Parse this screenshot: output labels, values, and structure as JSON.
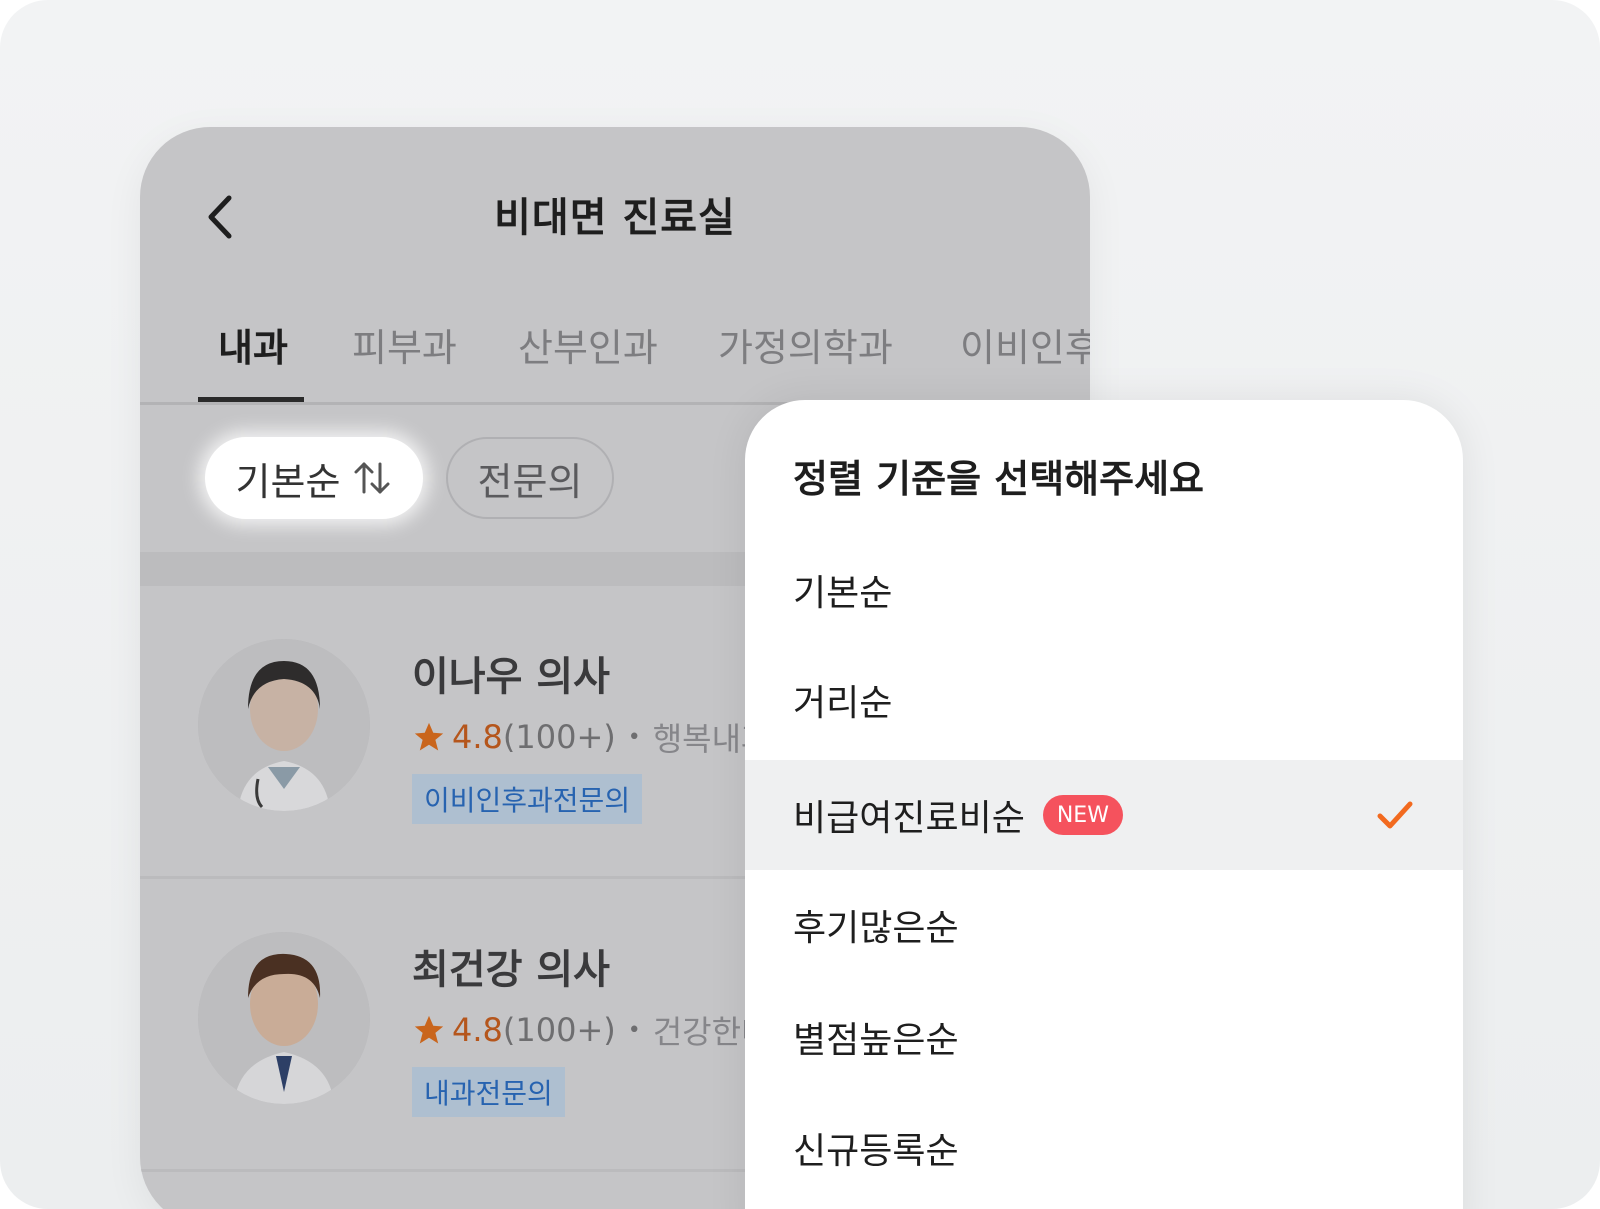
{
  "header": {
    "title": "비대면 진료실",
    "back_icon": "chevron-left-icon"
  },
  "tabs": [
    {
      "label": "내과",
      "active": true
    },
    {
      "label": "피부과",
      "active": false
    },
    {
      "label": "산부인과",
      "active": false
    },
    {
      "label": "가정의학과",
      "active": false
    },
    {
      "label": "이비인후",
      "active": false
    }
  ],
  "filters": {
    "sort_label": "기본순",
    "sort_icon": "sort-arrows-icon",
    "specialist_label": "전문의"
  },
  "doctors": [
    {
      "name": "이나우 의사",
      "rating": "4.8",
      "reviews": "(100+)",
      "separator": "•",
      "clinic": "행복내과",
      "specialty": "이비인후과전문의"
    },
    {
      "name": "최건강 의사",
      "rating": "4.8",
      "reviews": "(100+)",
      "separator": "•",
      "clinic": "건강한내",
      "specialty": "내과전문의"
    }
  ],
  "sort_sheet": {
    "title": "정렬 기준을 선택해주세요",
    "options": [
      {
        "label": "기본순"
      },
      {
        "label": "거리순"
      },
      {
        "label": "비급여진료비순",
        "badge": "NEW",
        "selected": true
      },
      {
        "label": "후기많은순"
      },
      {
        "label": "별점높은순"
      },
      {
        "label": "신규등록순"
      }
    ]
  },
  "colors": {
    "accent": "#f26a1f",
    "new_badge": "#f5525d",
    "specialty_text": "#2763b0"
  }
}
